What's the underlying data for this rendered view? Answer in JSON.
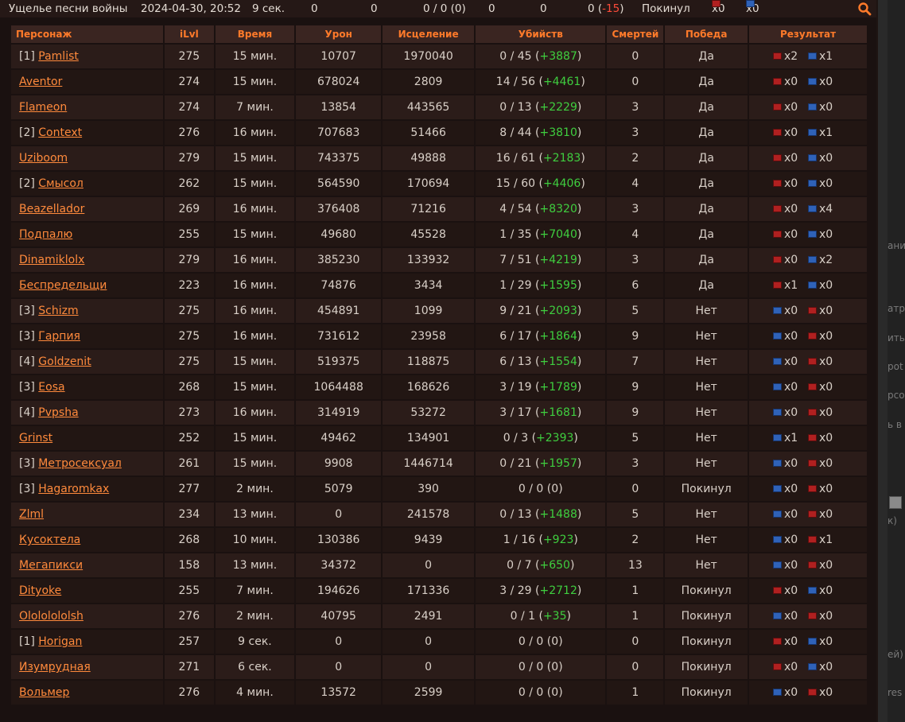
{
  "summary": {
    "map": "Ущелье песни войны",
    "datetime": "2024-04-30, 20:52",
    "duration": "9 сек.",
    "v1": "0",
    "v2": "0",
    "kills": "0 / 0 (0)",
    "v3": "0",
    "v4": "0",
    "rating_prefix": "0 (",
    "rating_change": "-15",
    "rating_suffix": ")",
    "result": "Покинул",
    "red_count": "x0",
    "blue_count": "x0"
  },
  "columns": [
    "Персонаж",
    "iLvl",
    "Время",
    "Урон",
    "Исцеление",
    "Убийств",
    "Смертей",
    "Победа",
    "Результат"
  ],
  "rows": [
    {
      "prefix": "[1] ",
      "name": "Pamlist",
      "ilvl": "275",
      "time": "15 мин.",
      "damage": "10707",
      "heal": "1970040",
      "kills": "0 / 45",
      "bonus": "+3887",
      "deaths": "0",
      "win": "Да",
      "f1": "red",
      "c1": "x2",
      "f2": "blue",
      "c2": "x1"
    },
    {
      "prefix": "",
      "name": "Aventor",
      "ilvl": "274",
      "time": "15 мин.",
      "damage": "678024",
      "heal": "2809",
      "kills": "14 / 56",
      "bonus": "+4461",
      "deaths": "0",
      "win": "Да",
      "f1": "red",
      "c1": "x0",
      "f2": "blue",
      "c2": "x0"
    },
    {
      "prefix": "",
      "name": "Flameon",
      "ilvl": "274",
      "time": "7 мин.",
      "damage": "13854",
      "heal": "443565",
      "kills": "0 / 13",
      "bonus": "+2229",
      "deaths": "3",
      "win": "Да",
      "f1": "red",
      "c1": "x0",
      "f2": "blue",
      "c2": "x0"
    },
    {
      "prefix": "[2] ",
      "name": "Context",
      "ilvl": "276",
      "time": "16 мин.",
      "damage": "707683",
      "heal": "51466",
      "kills": "8 / 44",
      "bonus": "+3810",
      "deaths": "3",
      "win": "Да",
      "f1": "red",
      "c1": "x0",
      "f2": "blue",
      "c2": "x1"
    },
    {
      "prefix": "",
      "name": "Uziboom",
      "ilvl": "279",
      "time": "15 мин.",
      "damage": "743375",
      "heal": "49888",
      "kills": "16 / 61",
      "bonus": "+2183",
      "deaths": "2",
      "win": "Да",
      "f1": "red",
      "c1": "x0",
      "f2": "blue",
      "c2": "x0"
    },
    {
      "prefix": "[2] ",
      "name": "Смысол",
      "ilvl": "262",
      "time": "15 мин.",
      "damage": "564590",
      "heal": "170694",
      "kills": "15 / 60",
      "bonus": "+4406",
      "deaths": "4",
      "win": "Да",
      "f1": "red",
      "c1": "x0",
      "f2": "blue",
      "c2": "x0"
    },
    {
      "prefix": "",
      "name": "Beazellador",
      "ilvl": "269",
      "time": "16 мин.",
      "damage": "376408",
      "heal": "71216",
      "kills": "4 / 54",
      "bonus": "+8320",
      "deaths": "3",
      "win": "Да",
      "f1": "red",
      "c1": "x0",
      "f2": "blue",
      "c2": "x4"
    },
    {
      "prefix": "",
      "name": "Подпалю",
      "ilvl": "255",
      "time": "15 мин.",
      "damage": "49680",
      "heal": "45528",
      "kills": "1 / 35",
      "bonus": "+7040",
      "deaths": "4",
      "win": "Да",
      "f1": "red",
      "c1": "x0",
      "f2": "blue",
      "c2": "x0"
    },
    {
      "prefix": "",
      "name": "Dinamiklolx",
      "ilvl": "279",
      "time": "16 мин.",
      "damage": "385230",
      "heal": "133932",
      "kills": "7 / 51",
      "bonus": "+4219",
      "deaths": "3",
      "win": "Да",
      "f1": "red",
      "c1": "x0",
      "f2": "blue",
      "c2": "x2"
    },
    {
      "prefix": "",
      "name": "Беспредельщи",
      "ilvl": "223",
      "time": "16 мин.",
      "damage": "74876",
      "heal": "3434",
      "kills": "1 / 29",
      "bonus": "+1595",
      "deaths": "6",
      "win": "Да",
      "f1": "red",
      "c1": "x1",
      "f2": "blue",
      "c2": "x0"
    },
    {
      "prefix": "[3] ",
      "name": "Schizm",
      "ilvl": "275",
      "time": "16 мин.",
      "damage": "454891",
      "heal": "1099",
      "kills": "9 / 21",
      "bonus": "+2093",
      "deaths": "5",
      "win": "Нет",
      "f1": "blue",
      "c1": "x0",
      "f2": "red",
      "c2": "x0"
    },
    {
      "prefix": "[3] ",
      "name": "Гарпия",
      "ilvl": "275",
      "time": "16 мин.",
      "damage": "731612",
      "heal": "23958",
      "kills": "6 / 17",
      "bonus": "+1864",
      "deaths": "9",
      "win": "Нет",
      "f1": "blue",
      "c1": "x0",
      "f2": "red",
      "c2": "x0"
    },
    {
      "prefix": "[4] ",
      "name": "Goldzenit",
      "ilvl": "275",
      "time": "15 мин.",
      "damage": "519375",
      "heal": "118875",
      "kills": "6 / 13",
      "bonus": "+1554",
      "deaths": "7",
      "win": "Нет",
      "f1": "blue",
      "c1": "x0",
      "f2": "red",
      "c2": "x0"
    },
    {
      "prefix": "[3] ",
      "name": "Eosa",
      "ilvl": "268",
      "time": "15 мин.",
      "damage": "1064488",
      "heal": "168626",
      "kills": "3 / 19",
      "bonus": "+1789",
      "deaths": "9",
      "win": "Нет",
      "f1": "blue",
      "c1": "x0",
      "f2": "red",
      "c2": "x0"
    },
    {
      "prefix": "[4] ",
      "name": "Pvpsha",
      "ilvl": "273",
      "time": "16 мин.",
      "damage": "314919",
      "heal": "53272",
      "kills": "3 / 17",
      "bonus": "+1681",
      "deaths": "9",
      "win": "Нет",
      "f1": "blue",
      "c1": "x0",
      "f2": "red",
      "c2": "x0"
    },
    {
      "prefix": "",
      "name": "Grinst",
      "ilvl": "252",
      "time": "15 мин.",
      "damage": "49462",
      "heal": "134901",
      "kills": "0 / 3",
      "bonus": "+2393",
      "deaths": "5",
      "win": "Нет",
      "f1": "blue",
      "c1": "x1",
      "f2": "red",
      "c2": "x0"
    },
    {
      "prefix": "[3] ",
      "name": "Метросексуал",
      "ilvl": "261",
      "time": "15 мин.",
      "damage": "9908",
      "heal": "1446714",
      "kills": "0 / 21",
      "bonus": "+1957",
      "deaths": "3",
      "win": "Нет",
      "f1": "blue",
      "c1": "x0",
      "f2": "red",
      "c2": "x0"
    },
    {
      "prefix": "[3] ",
      "name": "Hagaromkax",
      "ilvl": "277",
      "time": "2 мин.",
      "damage": "5079",
      "heal": "390",
      "kills": "0 / 0",
      "bonus": "0",
      "deaths": "0",
      "win": "Покинул",
      "f1": "blue",
      "c1": "x0",
      "f2": "red",
      "c2": "x0"
    },
    {
      "prefix": "",
      "name": "Zlml",
      "ilvl": "234",
      "time": "13 мин.",
      "damage": "0",
      "heal": "241578",
      "kills": "0 / 13",
      "bonus": "+1488",
      "deaths": "5",
      "win": "Нет",
      "f1": "blue",
      "c1": "x0",
      "f2": "red",
      "c2": "x0"
    },
    {
      "prefix": "",
      "name": "Кусоктела",
      "ilvl": "268",
      "time": "10 мин.",
      "damage": "130386",
      "heal": "9439",
      "kills": "1 / 16",
      "bonus": "+923",
      "deaths": "2",
      "win": "Нет",
      "f1": "blue",
      "c1": "x0",
      "f2": "red",
      "c2": "x1"
    },
    {
      "prefix": "",
      "name": "Мегапикси",
      "ilvl": "158",
      "time": "13 мин.",
      "damage": "34372",
      "heal": "0",
      "kills": "0 / 7",
      "bonus": "+650",
      "deaths": "13",
      "win": "Нет",
      "f1": "blue",
      "c1": "x0",
      "f2": "red",
      "c2": "x0"
    },
    {
      "prefix": "",
      "name": "Dityoke",
      "ilvl": "255",
      "time": "7 мин.",
      "damage": "194626",
      "heal": "171336",
      "kills": "3 / 29",
      "bonus": "+2712",
      "deaths": "1",
      "win": "Покинул",
      "f1": "red",
      "c1": "x0",
      "f2": "blue",
      "c2": "x0"
    },
    {
      "prefix": "",
      "name": "Olololololsh",
      "ilvl": "276",
      "time": "2 мин.",
      "damage": "40795",
      "heal": "2491",
      "kills": "0 / 1",
      "bonus": "+35",
      "deaths": "1",
      "win": "Покинул",
      "f1": "blue",
      "c1": "x0",
      "f2": "red",
      "c2": "x0"
    },
    {
      "prefix": "[1] ",
      "name": "Horigan",
      "ilvl": "257",
      "time": "9 сек.",
      "damage": "0",
      "heal": "0",
      "kills": "0 / 0",
      "bonus": "0",
      "deaths": "0",
      "win": "Покинул",
      "f1": "red",
      "c1": "x0",
      "f2": "blue",
      "c2": "x0"
    },
    {
      "prefix": "",
      "name": "Изумрудная",
      "ilvl": "271",
      "time": "6 сек.",
      "damage": "0",
      "heal": "0",
      "kills": "0 / 0",
      "bonus": "0",
      "deaths": "0",
      "win": "Покинул",
      "f1": "red",
      "c1": "x0",
      "f2": "blue",
      "c2": "x0"
    },
    {
      "prefix": "",
      "name": "Вольмер",
      "ilvl": "276",
      "time": "4 мин.",
      "damage": "13572",
      "heal": "2599",
      "kills": "0 / 0",
      "bonus": "0",
      "deaths": "1",
      "win": "Покинул",
      "f1": "blue",
      "c1": "x0",
      "f2": "red",
      "c2": "x0"
    }
  ],
  "sidebar_fragments": [
    {
      "text": "ани"
    },
    {
      "text": "атр"
    },
    {
      "text": "ить"
    },
    {
      "text": "pot"
    },
    {
      "text": "рсо"
    },
    {
      "text": "ь в"
    },
    {
      "text": "к)"
    },
    {
      "text": "ей)"
    },
    {
      "text": "res"
    }
  ],
  "colors": {
    "accent": "#ff7a2a",
    "bonus_positive": "#3fce3f",
    "rating_negative": "#ff4b3a"
  },
  "icons": {
    "search": "search-icon",
    "team_red": "red-flag-icon",
    "team_blue": "blue-flag-icon"
  }
}
